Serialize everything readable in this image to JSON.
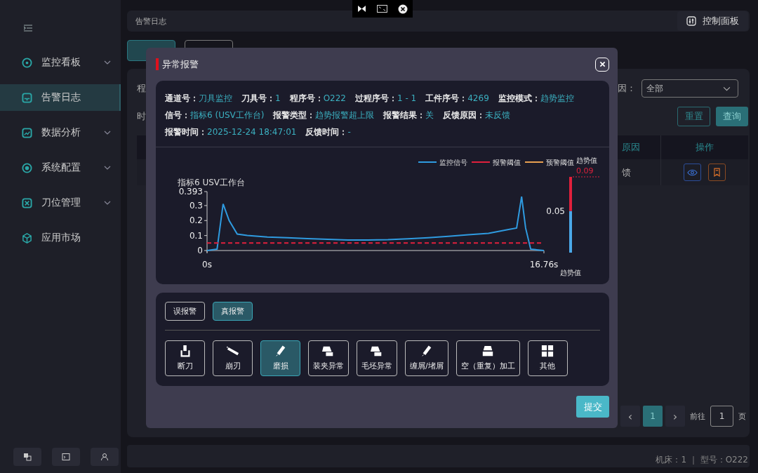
{
  "sidebar": {
    "items": [
      {
        "label": "监控看板",
        "selected": false,
        "expandable": true
      },
      {
        "label": "告警日志",
        "selected": true,
        "expandable": false
      },
      {
        "label": "数据分析",
        "selected": false,
        "expandable": true
      },
      {
        "label": "系统配置",
        "selected": false,
        "expandable": true
      },
      {
        "label": "刀位管理",
        "selected": false,
        "expandable": true
      },
      {
        "label": "应用市场",
        "selected": false,
        "expandable": false
      }
    ]
  },
  "breadcrumb": "告警日志",
  "control_panel_button": "控制面板",
  "tabs": [
    {
      "selected": true
    },
    {
      "selected": false
    }
  ],
  "filters": {
    "label_1": "程",
    "label_2": "时",
    "label_3": "因：",
    "select_value": "全部",
    "reset_button": "重置",
    "query_button": "查询"
  },
  "table": {
    "columns": [
      "原因",
      "操作"
    ],
    "rows": [
      {
        "reason": "馈"
      }
    ]
  },
  "pagination": {
    "prev": "‹",
    "pages": [
      {
        "label": "1",
        "selected": true
      }
    ],
    "next": "›",
    "goto_label": "前往",
    "goto_value": "1",
    "page_suffix": "页"
  },
  "status_bar": "机床：1 ｜ 型号：O222",
  "dialog": {
    "title": "异常报警",
    "info": [
      [
        {
          "label": "通道号：",
          "value": "刀具监控"
        },
        {
          "label": "刀具号：",
          "value": "1"
        },
        {
          "label": "程序号：",
          "value": "O222"
        },
        {
          "label": "过程序号：",
          "value": "1 - 1"
        },
        {
          "label": "工件序号：",
          "value": "4269"
        },
        {
          "label": "监控模式：",
          "value": "趋势监控"
        }
      ],
      [
        {
          "label": "信号：",
          "value": "指标6 (USV工作台)"
        },
        {
          "label": "报警类型：",
          "value": "趋势报警超上限"
        },
        {
          "label": "报警结果：",
          "value": "关"
        },
        {
          "label": "反馈原因：",
          "value": "未反馈"
        }
      ],
      [
        {
          "label": "报警时间：",
          "value": "2025-12-24 18:47:01"
        },
        {
          "label": "反馈时间：",
          "value": "-"
        }
      ]
    ],
    "chart_data": {
      "type": "line",
      "title": "指标6 USV工作台",
      "x": [
        0,
        0.5,
        0.8,
        1.1,
        1.5,
        2,
        3,
        4,
        5,
        6,
        7,
        8,
        9,
        10,
        11,
        12,
        13,
        14,
        15,
        15.4,
        15.65,
        15.85,
        16.1,
        16.4,
        16.76
      ],
      "series": [
        {
          "name": "监控信号",
          "color": "#2f9be0",
          "values": [
            0,
            0.01,
            0.31,
            0.2,
            0.11,
            0.1,
            0.09,
            0.085,
            0.08,
            0.075,
            0.07,
            0.07,
            0.072,
            0.078,
            0.085,
            0.095,
            0.105,
            0.115,
            0.14,
            0.15,
            0.36,
            0.15,
            0.01,
            0.005,
            0
          ]
        },
        {
          "name": "报警阈值",
          "color": "#e0203c",
          "line_style": "dashed",
          "values": [
            0.05,
            0.05,
            0.05,
            0.05,
            0.05,
            0.05,
            0.05,
            0.05,
            0.05,
            0.05,
            0.05,
            0.05,
            0.05,
            0.05,
            0.05,
            0.05,
            0.05,
            0.05,
            0.05,
            0.05,
            0.05,
            0.05,
            0.05,
            0.05,
            0.05
          ]
        },
        {
          "name": "预警阈值",
          "color": "#e8a050",
          "values": [
            null,
            null,
            null,
            null,
            null,
            null,
            null,
            null,
            null,
            null,
            null,
            null,
            null,
            null,
            null,
            null,
            null,
            null,
            null,
            null,
            null,
            null,
            null,
            null,
            null
          ]
        }
      ],
      "legend": "top",
      "xlim": [
        0,
        16.76
      ],
      "ylim": [
        0,
        0.393
      ],
      "xticks": [
        {
          "value": 0,
          "label": "0s"
        },
        {
          "value": 16.76,
          "label": "16.76s"
        }
      ],
      "yticks": [
        0,
        0.1,
        0.2,
        0.3,
        0.393
      ]
    },
    "trend_gauge": {
      "title": "趋势值",
      "threshold_label": "0.05",
      "value_label": "0.09",
      "axis_label": "趋势值"
    },
    "verdicts": [
      {
        "label": "误报警",
        "selected": false
      },
      {
        "label": "真报警",
        "selected": true
      }
    ],
    "causes": [
      {
        "label": "断刀",
        "selected": false
      },
      {
        "label": "崩刃",
        "selected": false
      },
      {
        "label": "磨损",
        "selected": true
      },
      {
        "label": "装夹异常",
        "selected": false
      },
      {
        "label": "毛坯异常",
        "selected": false
      },
      {
        "label": "缠屑/堵屑",
        "selected": false
      },
      {
        "label": "空（重复）加工",
        "selected": false
      },
      {
        "label": "其他",
        "selected": false
      }
    ],
    "submit_button": "提交"
  }
}
